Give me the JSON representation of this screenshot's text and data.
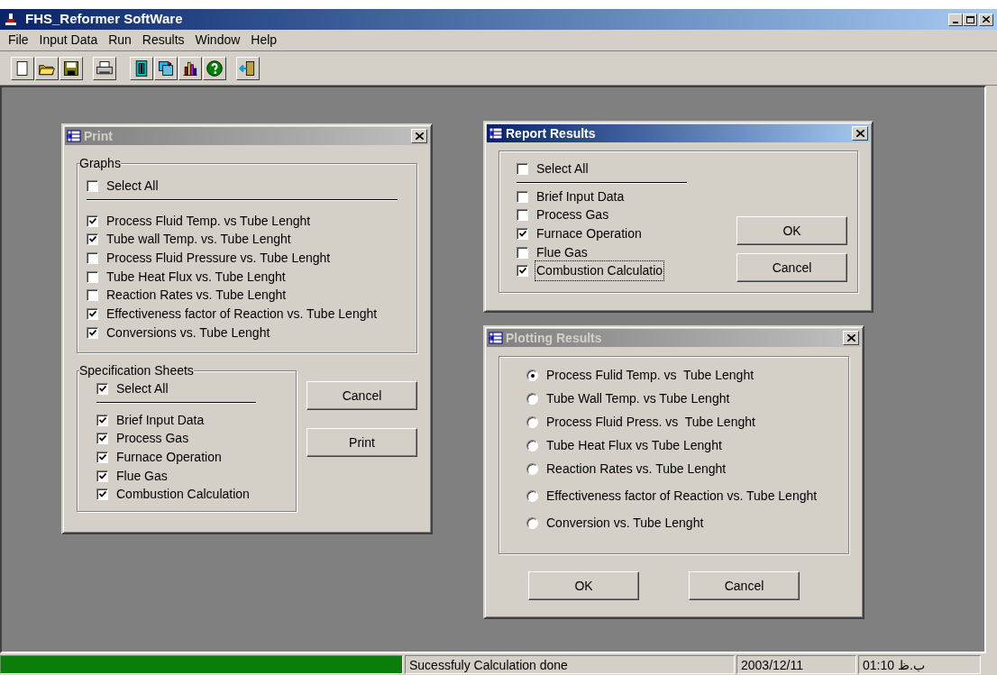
{
  "window": {
    "title": "FHS_Reformer SoftWare"
  },
  "menu": [
    "File",
    "Input Data",
    "Run",
    "Results",
    "Window",
    "Help"
  ],
  "print_dialog": {
    "title": "Print",
    "active": false,
    "graphs": {
      "legend": "Graphs",
      "select_all": {
        "label": "Select All",
        "checked": false
      },
      "items": [
        {
          "label": "Process Fluid Temp. vs Tube Lenght",
          "checked": true
        },
        {
          "label": "Tube wall Temp. vs. Tube Lenght",
          "checked": true
        },
        {
          "label": "Process Fluid Pressure vs. Tube Lenght",
          "checked": false
        },
        {
          "label": "Tube Heat Flux vs. Tube Lenght",
          "checked": false
        },
        {
          "label": "Reaction Rates vs. Tube Lenght",
          "checked": false
        },
        {
          "label": "Effectiveness factor of Reaction vs. Tube Lenght",
          "checked": true
        },
        {
          "label": "Conversions vs. Tube Lenght",
          "checked": true
        }
      ]
    },
    "spec_sheets": {
      "legend": "Specification Sheets",
      "select_all": {
        "label": "Select All",
        "checked": true
      },
      "items": [
        {
          "label": "Brief Input Data",
          "checked": true
        },
        {
          "label": "Process Gas",
          "checked": true
        },
        {
          "label": "Furnace Operation",
          "checked": true
        },
        {
          "label": "Flue Gas",
          "checked": true
        },
        {
          "label": "Combustion Calculation",
          "checked": true
        }
      ]
    },
    "buttons": [
      "Cancel",
      "Print"
    ]
  },
  "report_dialog": {
    "title": "Report Results",
    "active": true,
    "select_all": {
      "label": "Select All",
      "checked": false
    },
    "items": [
      {
        "label": "Brief Input Data",
        "checked": false,
        "focused": false
      },
      {
        "label": "Process Gas",
        "checked": false,
        "focused": false
      },
      {
        "label": "Furnace Operation",
        "checked": true,
        "focused": false
      },
      {
        "label": "Flue Gas",
        "checked": false,
        "focused": false
      },
      {
        "label": "Combustion Calculatio",
        "checked": true,
        "focused": true
      }
    ],
    "buttons": [
      "OK",
      "Cancel"
    ]
  },
  "plot_dialog": {
    "title": "Plotting Results",
    "active": false,
    "options": [
      {
        "label": "Process Fulid Temp. vs  Tube Lenght",
        "selected": true
      },
      {
        "label": "Tube Wall Temp. vs Tube Lenght",
        "selected": false
      },
      {
        "label": "Process Fluid Press. vs  Tube Lenght",
        "selected": false
      },
      {
        "label": "Tube Heat Flux vs Tube Lenght",
        "selected": false
      },
      {
        "label": "Reaction Rates vs. Tube Lenght",
        "selected": false
      },
      {
        "label": "Effectiveness factor of Reaction vs. Tube Lenght",
        "selected": false
      },
      {
        "label": "Conversion vs. Tube Lenght",
        "selected": false
      }
    ],
    "buttons": [
      "OK",
      "Cancel"
    ]
  },
  "status_bar": {
    "progress": {
      "level": 1
    },
    "message": "Sucessfuly Calculation done",
    "date": "2003/12/11",
    "time": "01:10 ب.ظ"
  }
}
